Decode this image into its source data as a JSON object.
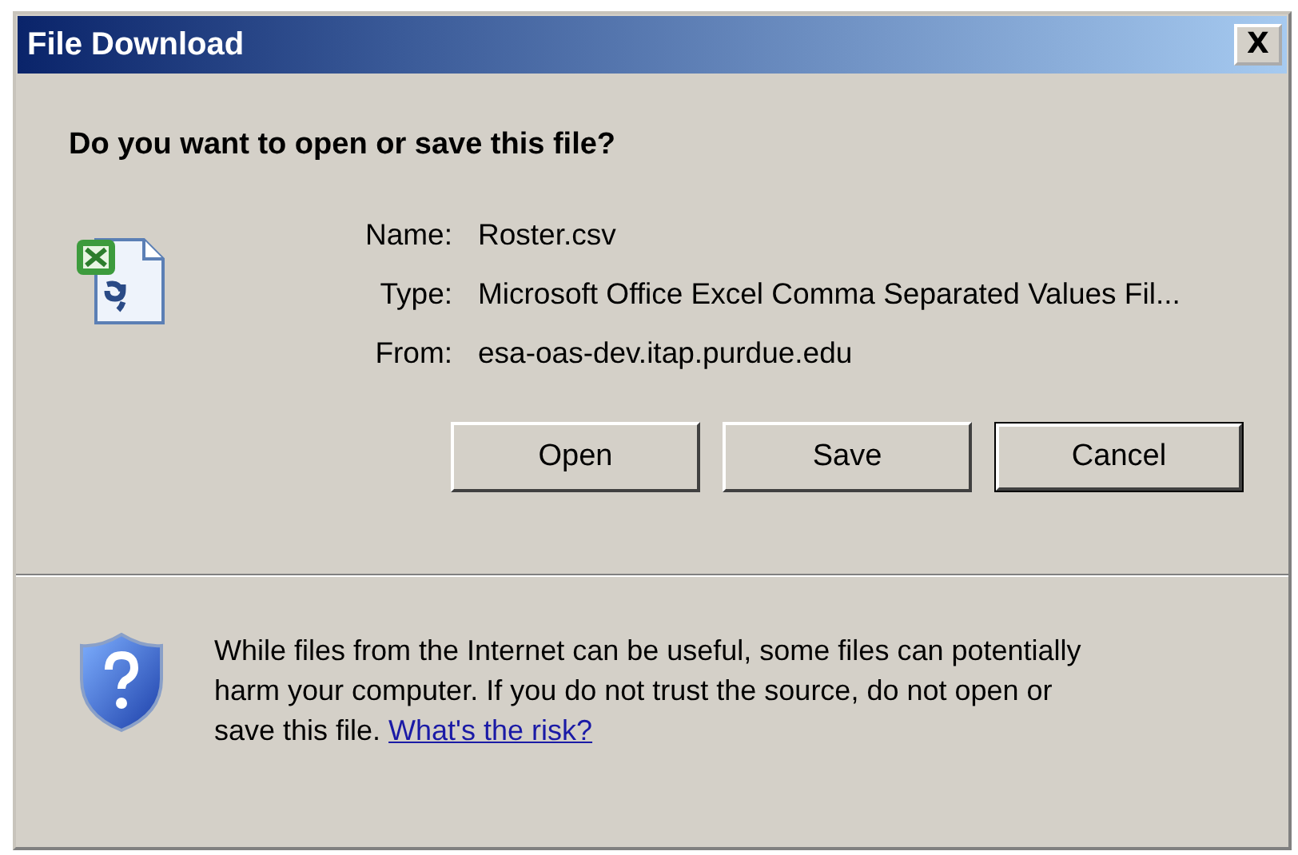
{
  "window": {
    "title": "File Download",
    "close_label": "X"
  },
  "heading": "Do you want to open or save this file?",
  "file_info": [
    {
      "label": "Name:",
      "value": "Roster.csv"
    },
    {
      "label": "Type:",
      "value": "Microsoft Office Excel Comma Separated Values Fil..."
    },
    {
      "label": "From:",
      "value": "esa-oas-dev.itap.purdue.edu"
    }
  ],
  "buttons": [
    {
      "label": "Open",
      "default": false
    },
    {
      "label": "Save",
      "default": false
    },
    {
      "label": "Cancel",
      "default": true
    }
  ],
  "warning": {
    "text": "While files from the Internet can be useful, some files can potentially harm your computer. If you do not trust the source, do not open or save this file.",
    "link": "What's the risk?"
  }
}
